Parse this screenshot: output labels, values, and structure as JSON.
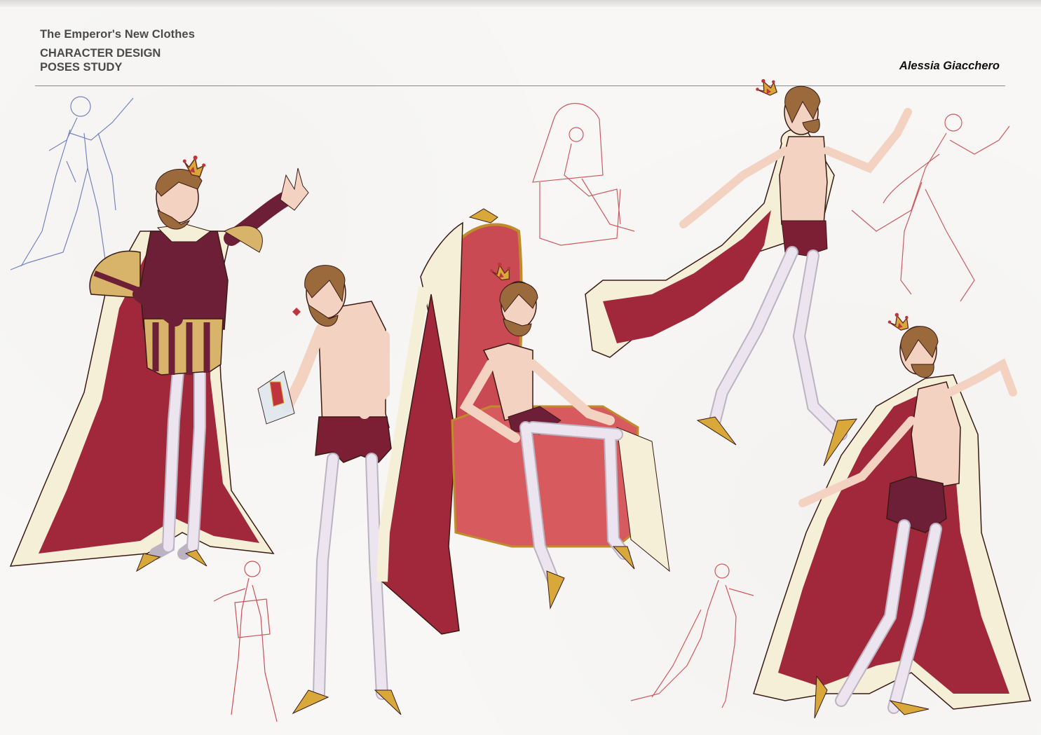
{
  "header": {
    "title": "The Emperor's New Clothes",
    "subtitle_line1": "CHARACTER DESIGN",
    "subtitle_line2": "POSES STUDY",
    "author": "Alessia Giacchero"
  },
  "palette": {
    "paper": "#f8f7f5",
    "robe_red": "#a1283a",
    "fur_cream": "#f6efd8",
    "tunic_plum": "#6d1f38",
    "gold": "#d9a83a",
    "tights": "#ece4ee",
    "skin": "#f3d2c2",
    "hair": "#9a6a3c",
    "throne_red": "#d75a5f",
    "sketch_red": "#c0353d",
    "sketch_blue": "#5668b2"
  },
  "figures": [
    {
      "id": "emperor-dressed",
      "icon": "dressed-emperor-figure"
    },
    {
      "id": "emperor-holding-cloth",
      "icon": "shy-emperor-figure"
    },
    {
      "id": "emperor-on-throne",
      "icon": "throne-emperor-figure"
    },
    {
      "id": "emperor-walking-cape",
      "icon": "walking-emperor-figure"
    },
    {
      "id": "emperor-posing-back",
      "icon": "posing-emperor-figure"
    }
  ]
}
